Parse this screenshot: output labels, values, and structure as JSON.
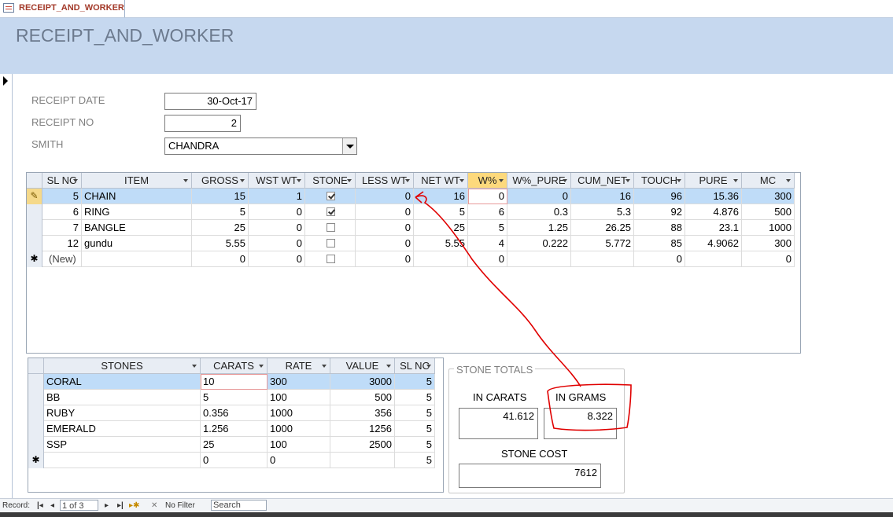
{
  "tab": {
    "label": "RECEIPT_AND_WORKER"
  },
  "form": {
    "title": "RECEIPT_AND_WORKER"
  },
  "fields": {
    "receipt_date": {
      "label": "RECEIPT DATE",
      "value": "30-Oct-17"
    },
    "receipt_no": {
      "label": "RECEIPT NO",
      "value": "2"
    },
    "smith": {
      "label": "SMITH",
      "value": "CHANDRA"
    }
  },
  "items_grid": {
    "columns": [
      "SL NC",
      "ITEM",
      "GROSS",
      "WST WT",
      "STONE",
      "LESS WT",
      "NET WT",
      "W%",
      "W%_PURE",
      "CUM_NET",
      "TOUCH",
      "PURE",
      "MC"
    ],
    "rows": [
      {
        "sl": "5",
        "item": "CHAIN",
        "gross": "15",
        "wst": "1",
        "stone": true,
        "less": "0",
        "net": "16",
        "wpct": "0",
        "wpure": "0",
        "cum": "16",
        "touch": "96",
        "pure": "15.36",
        "mc": "300"
      },
      {
        "sl": "6",
        "item": "RING",
        "gross": "5",
        "wst": "0",
        "stone": true,
        "less": "0",
        "net": "5",
        "wpct": "6",
        "wpure": "0.3",
        "cum": "5.3",
        "touch": "92",
        "pure": "4.876",
        "mc": "500"
      },
      {
        "sl": "7",
        "item": "BANGLE",
        "gross": "25",
        "wst": "0",
        "stone": false,
        "less": "0",
        "net": "25",
        "wpct": "5",
        "wpure": "1.25",
        "cum": "26.25",
        "touch": "88",
        "pure": "23.1",
        "mc": "1000"
      },
      {
        "sl": "12",
        "item": "gundu",
        "gross": "5.55",
        "wst": "0",
        "stone": false,
        "less": "0",
        "net": "5.55",
        "wpct": "4",
        "wpure": "0.222",
        "cum": "5.772",
        "touch": "85",
        "pure": "4.9062",
        "mc": "300"
      }
    ],
    "new_row": {
      "label": "(New)",
      "gross": "0",
      "wst": "0",
      "less": "0",
      "wpct": "0",
      "touch": "0",
      "mc": "0"
    }
  },
  "stones_grid": {
    "columns": [
      "STONES",
      "CARATS",
      "RATE",
      "VALUE",
      "SL NC"
    ],
    "rows": [
      {
        "stone": "CORAL",
        "carats": "10",
        "rate": "300",
        "value": "3000",
        "sl": "5"
      },
      {
        "stone": "BB",
        "carats": "5",
        "rate": "100",
        "value": "500",
        "sl": "5"
      },
      {
        "stone": "RUBY",
        "carats": "0.356",
        "rate": "1000",
        "value": "356",
        "sl": "5"
      },
      {
        "stone": "EMERALD",
        "carats": "1.256",
        "rate": "1000",
        "value": "1256",
        "sl": "5"
      },
      {
        "stone": "SSP",
        "carats": "25",
        "rate": "100",
        "value": "2500",
        "sl": "5"
      }
    ],
    "new_row": {
      "carats": "0",
      "rate": "0",
      "sl": "5"
    }
  },
  "totals": {
    "title": "STONE TOTALS",
    "carats_label": "IN CARATS",
    "carats_value": "41.612",
    "grams_label": "IN GRAMS",
    "grams_value": "8.322",
    "cost_label": "STONE COST",
    "cost_value": "7612"
  },
  "status": {
    "record_label": "Record:",
    "record_value": "1 of 3",
    "filter_label": "No Filter",
    "search_label": "Search"
  },
  "icons": [
    "form-icon",
    "pencil-icon",
    "new-record-star-icon",
    "first-record-icon",
    "prev-record-icon",
    "next-record-icon",
    "last-record-icon",
    "new-record-icon",
    "filter-icon",
    "dropdown-arrow-icon"
  ],
  "colors": {
    "header_bg": "#c6d8ef",
    "current_row": "#bfdcf8",
    "selected_header": "#fdd97c",
    "annotation": "#e00000"
  }
}
